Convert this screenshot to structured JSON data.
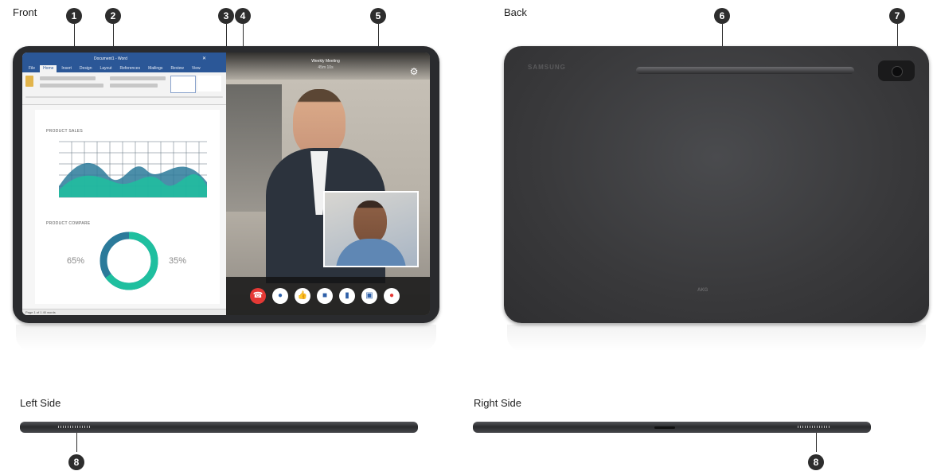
{
  "labels": {
    "front": "Front",
    "back": "Back",
    "left_side": "Left Side",
    "right_side": "Right Side"
  },
  "callouts": [
    "1",
    "2",
    "3",
    "4",
    "5",
    "6",
    "7",
    "8",
    "8"
  ],
  "front_screen": {
    "doc_app": {
      "title": "Document1 - Word",
      "tabs": [
        "File",
        "Home",
        "Insert",
        "Design",
        "Layout",
        "References",
        "Mailings",
        "Review",
        "View"
      ],
      "chart_heading": "PRODUCT SALES",
      "donut_heading": "PRODUCT COMPARE",
      "donut_left": "65%",
      "donut_right": "35%",
      "status": "Page 1 of 1   40 words"
    },
    "video_app": {
      "title": "Weekly Meeting",
      "subtitle": "45m 10s",
      "settings_icon": "gear-icon",
      "call_controls": [
        "end-call-icon",
        "microphone-icon",
        "thumbs-up-icon",
        "chat-icon",
        "clipboard-icon",
        "screen-share-icon",
        "record-icon"
      ]
    }
  },
  "back_panel": {
    "brand": "SAMSUNG",
    "contact_mark": "AKG"
  },
  "colors": {
    "callout_fill": "#2d2d2d",
    "end_call": "#e53935",
    "record": "#e53935",
    "chart_primary": "#1fbf9f",
    "chart_secondary": "#2b7a9a"
  }
}
